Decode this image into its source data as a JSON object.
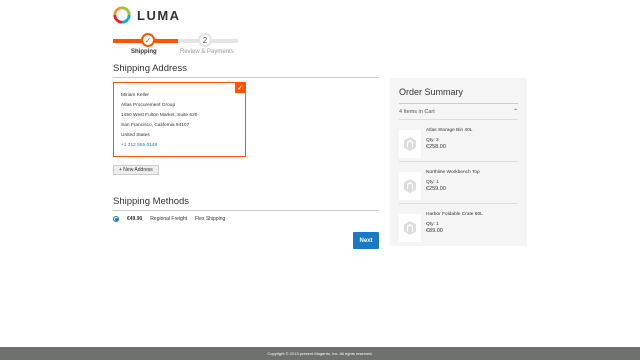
{
  "brand": {
    "name": "LUMA"
  },
  "progress": {
    "steps": [
      {
        "label": "Shipping",
        "status": "complete"
      },
      {
        "label": "Review & Payments",
        "number": "2",
        "status": "pending"
      }
    ]
  },
  "shipping_address": {
    "title": "Shipping Address",
    "card": {
      "name": "Miriam Keller",
      "company": "Atlas Procurement Group",
      "street": "1450 West Fulton Market, Suite 620",
      "city_line": "San Francisco, California 94107",
      "country": "United States",
      "phone": "+1 312 555 0148"
    },
    "new_address_label": "+ New Address"
  },
  "shipping_methods": {
    "title": "Shipping Methods",
    "options": [
      {
        "price": "€49.90",
        "method": "Regional Freight",
        "carrier": "Flex Shipping",
        "selected": true
      }
    ],
    "next_label": "Next"
  },
  "order_summary": {
    "title": "Order Summary",
    "cart_label": "4 Items in Cart",
    "items": [
      {
        "name": "Atlas Storage Bin 40L",
        "qty": "Qty: 2",
        "price": "€258.00"
      },
      {
        "name": "Northline Workbench Top",
        "qty": "Qty: 1",
        "price": "€259.00"
      },
      {
        "name": "Harbor Foldable Crate 60L",
        "qty": "Qty: 1",
        "price": "€89.00"
      }
    ]
  },
  "footer": {
    "text": "Copyright © 2013-present Magento, Inc. All rights reserved."
  },
  "colors": {
    "accent": "#ff5501",
    "link": "#1979c3",
    "footer_bg": "#6e716e"
  }
}
